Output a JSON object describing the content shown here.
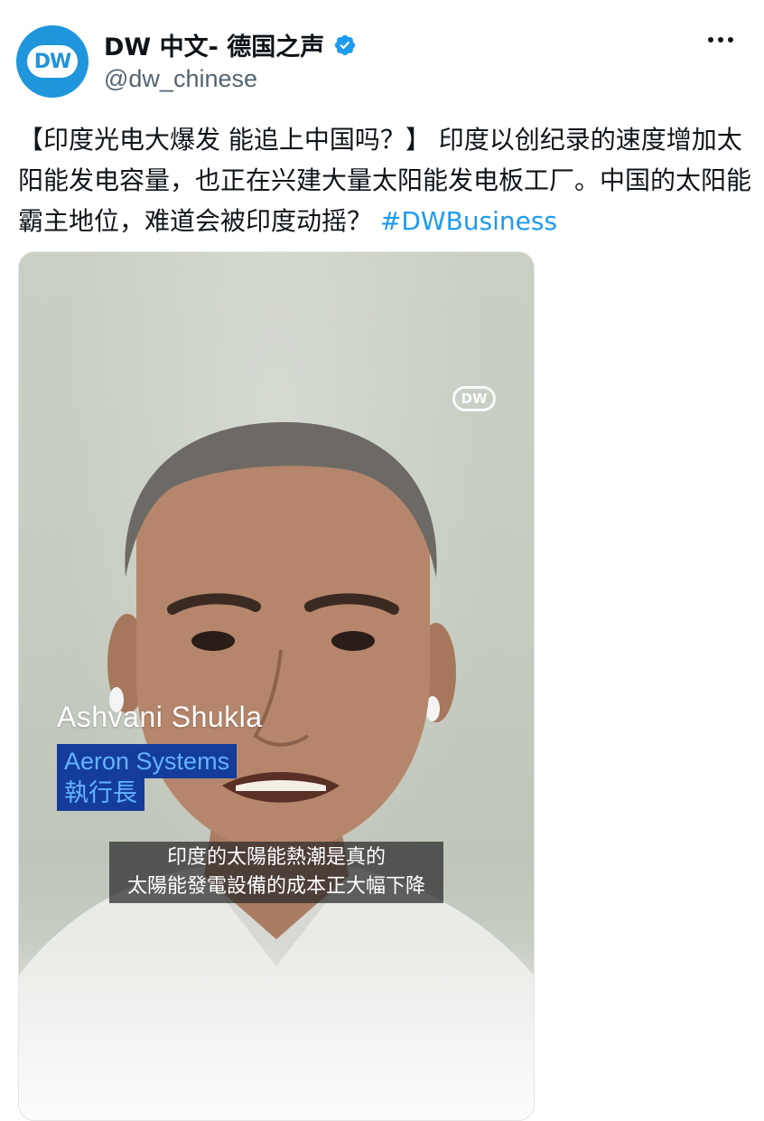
{
  "post": {
    "author": {
      "display_name": "DW 中文- 德国之声",
      "handle": "@dw_chinese",
      "avatar_logo_text": "DW",
      "verified": true,
      "verified_color": "#1d9bf0"
    },
    "more_icon": "more-horizontal-icon",
    "text": "【印度光电大爆发 能追上中国吗？】 印度以创纪录的速度增加太阳能发电容量，也正在兴建大量太阳能发电板工厂。中国的太阳能霸主地位，难道会被印度动摇？ ",
    "hashtag": "#DWBusiness",
    "hashtag_color": "#1d9bf0"
  },
  "video": {
    "watermark": "DW",
    "lower_third": {
      "name": "Ashvani Shukla",
      "organization": "Aeron Systems",
      "role": "執行長"
    },
    "subtitles": [
      "印度的太陽能熱潮是真的",
      "太陽能發電設備的成本正大幅下降"
    ]
  }
}
